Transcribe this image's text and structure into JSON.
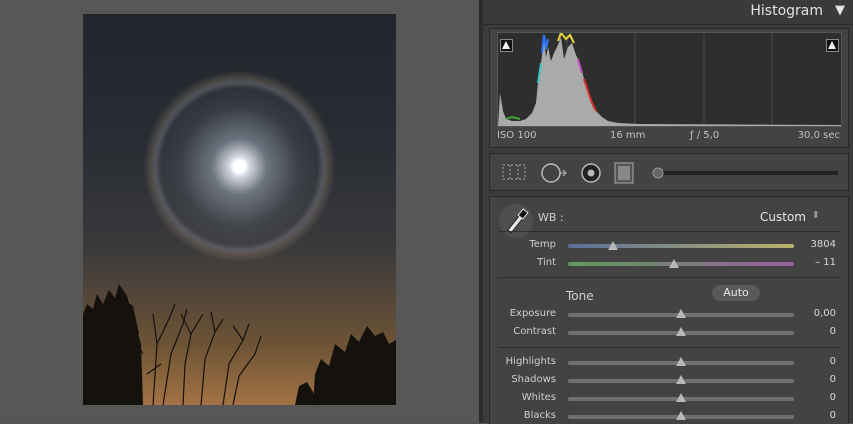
{
  "histogram": {
    "title": "Histogram",
    "toggle_icon": "triangle-down-icon",
    "exif": {
      "iso": "ISO 100",
      "focal": "16 mm",
      "aperture": "ƒ / 5,0",
      "shutter": "30,0 sec"
    }
  },
  "toolstrip": {
    "tools": [
      "crop-overlay-icon",
      "spot-removal-icon",
      "red-eye-icon",
      "graduated-filter-icon",
      "adjustment-brush-slider"
    ]
  },
  "basic": {
    "wb_label": "WB :",
    "wb_value": "Custom",
    "wb_arrows": "⬍",
    "tone_label": "Tone",
    "auto_label": "Auto",
    "sliders": {
      "temp": {
        "label": "Temp",
        "value": "3804",
        "position": 0.2
      },
      "tint": {
        "label": "Tint",
        "value": "– 11",
        "position": 0.47
      },
      "exposure": {
        "label": "Exposure",
        "value": "0,00",
        "position": 0.5
      },
      "contrast": {
        "label": "Contrast",
        "value": "0",
        "position": 0.5
      },
      "highlights": {
        "label": "Highlights",
        "value": "0",
        "position": 0.5
      },
      "shadows": {
        "label": "Shadows",
        "value": "0",
        "position": 0.5
      },
      "whites": {
        "label": "Whites",
        "value": "0",
        "position": 0.5
      },
      "blacks": {
        "label": "Blacks",
        "value": "0",
        "position": 0.5
      }
    }
  },
  "colors": {
    "panel_bg": "#434343",
    "app_bg": "#535353",
    "temp_track_start": "#5a6e9a",
    "temp_track_end": "#b9b26a",
    "tint_track_start": "#5f9a5a",
    "tint_track_end": "#9a5fa0"
  }
}
